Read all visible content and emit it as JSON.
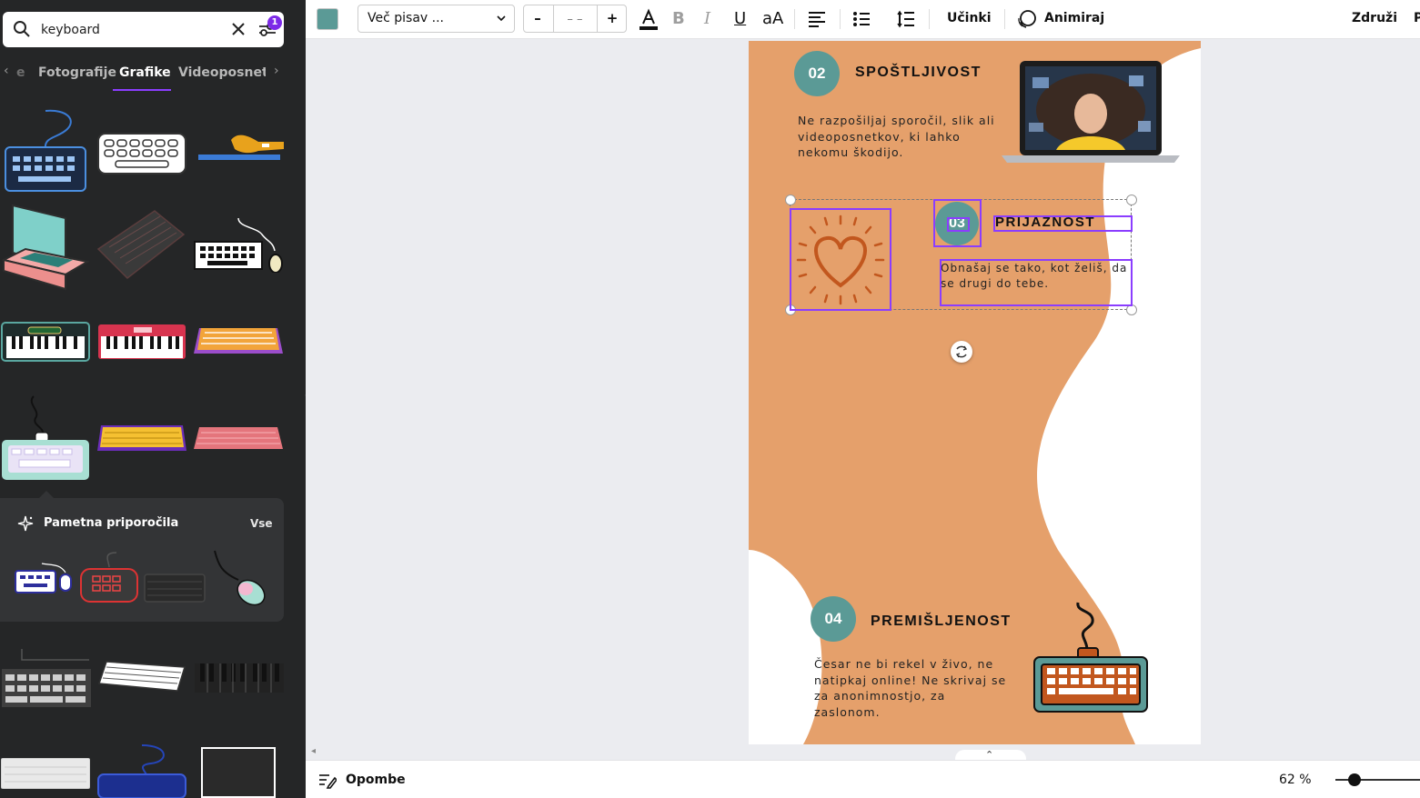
{
  "search": {
    "value": "keyboard",
    "filter_count": "1"
  },
  "tabs": {
    "prev_label": "e",
    "items": [
      {
        "label": "Fotografije"
      },
      {
        "label": "Grafike"
      },
      {
        "label": "Videoposnetki"
      }
    ]
  },
  "smart_suggestions": {
    "title": "Pametna priporočila",
    "all_label": "Vse"
  },
  "toolbar": {
    "text_color": "#5b9a96",
    "font_label": "Več pisav ...",
    "font_size_value": "– –",
    "minus_label": "–",
    "plus_label": "+",
    "effects_label": "Učinki",
    "animate_label": "Animiraj",
    "merge_label": "Združi",
    "cut_label": "P"
  },
  "design": {
    "accent_orange": "#e5a06b",
    "teal": "#5b9a96",
    "sections": [
      {
        "number": "02",
        "title": "SPOŠTLJIVOST",
        "body": "Ne razpošiljaj sporočil, slik ali videoposnetkov, ki lahko nekomu škodijo."
      },
      {
        "number": "03",
        "title": "PRIJAZNOST",
        "body": "Obnašaj se tako, kot želiš, da se drugi do tebe."
      },
      {
        "number": "04",
        "title": "PREMIŠLJENOST",
        "body": "Česar ne bi rekel v živo, ne natipkaj online! Ne skrivaj se za anonimnostjo, za zaslonom."
      }
    ]
  },
  "bottom": {
    "notes_label": "Opombe",
    "zoom_label": "62 %"
  }
}
